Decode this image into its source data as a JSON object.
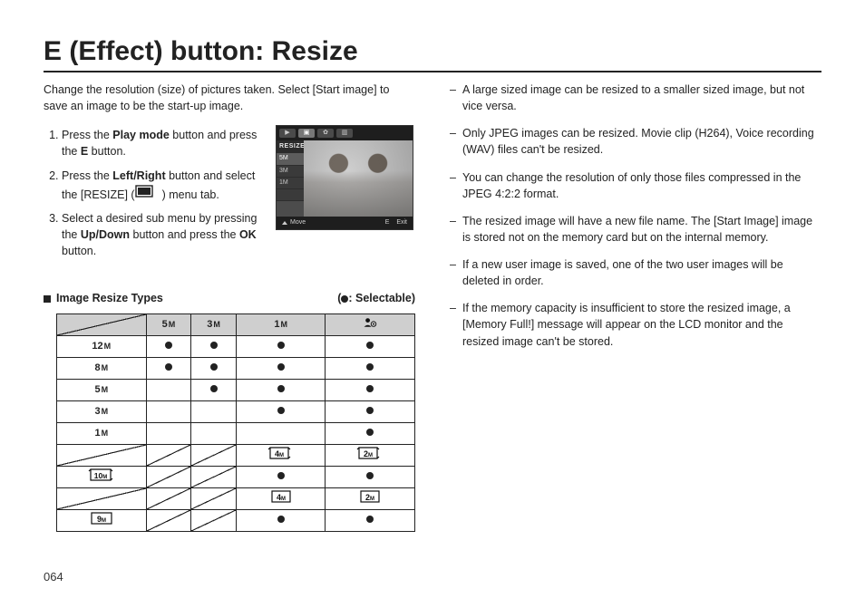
{
  "title": "E (Effect) button: Resize",
  "intro": "Change the resolution (size) of pictures taken. Select [Start image] to save an image to be the start-up image.",
  "steps": {
    "s1a": "Press the ",
    "s1b": "Play mode",
    "s1c": " button and press the ",
    "s1d": "E",
    "s1e": " button.",
    "s2a": "Press the ",
    "s2b": "Left/Right",
    "s2c": " button and select the [RESIZE] (",
    "s2d": ") menu tab.",
    "s3a": "Select a desired sub menu by pressing the ",
    "s3b": "Up/Down",
    "s3c": " button and press the ",
    "s3d": "OK",
    "s3e": " button."
  },
  "thumb": {
    "label": "RESIZE",
    "items": [
      "5M",
      "3M",
      "1M"
    ],
    "move": "Move",
    "exit": "Exit",
    "ekey": "E"
  },
  "table": {
    "heading": "Image Resize Types",
    "legend": "(    : Selectable)",
    "cols": {
      "c1": "5",
      "c1m": "M",
      "c2": "3",
      "c2m": "M",
      "c3": "1",
      "c3m": "M"
    },
    "rows": {
      "r1": "12",
      "r1m": "M",
      "r2": "8",
      "r2m": "M",
      "r3": "5",
      "r3m": "M",
      "r4": "3",
      "r4m": "M",
      "r5": "1",
      "r5m": "M",
      "w1": "10",
      "w1m": "M",
      "w2": "9",
      "w2m": "M"
    },
    "wide": {
      "a": "4",
      "am": "M",
      "b": "2",
      "bm": "M"
    }
  },
  "notes": {
    "n1": "A large sized image can be resized to a smaller sized image, but not vice versa.",
    "n2": "Only JPEG images can be resized. Movie clip (H264), Voice recording (WAV) files can't be resized.",
    "n3": "You can change the resolution of only those files compressed in the JPEG 4:2:2 format.",
    "n4": "The resized image will have a new file name. The [Start Image] image is stored not on the memory card but on the internal memory.",
    "n5": "If a new user image is saved, one of the two user images will be deleted in order.",
    "n6": "If the memory capacity is insufficient to store the resized image, a [Memory Full!] message will appear on the LCD monitor and the resized image can't be stored."
  },
  "pagenum": "064"
}
